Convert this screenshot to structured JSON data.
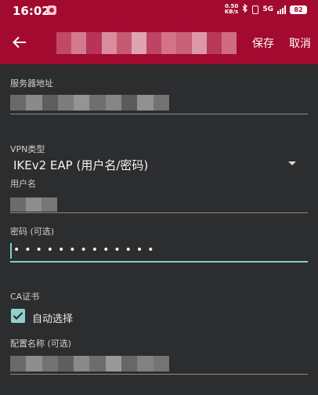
{
  "status_bar": {
    "time": "16:02",
    "net_speed_value": "0.50",
    "net_speed_unit": "KB/s",
    "network": "5G",
    "battery": "82"
  },
  "toolbar": {
    "save_label": "保存",
    "cancel_label": "取消"
  },
  "form": {
    "server_label": "服务器地址",
    "vpn_type_label": "VPN类型",
    "vpn_type_value": "IKEv2 EAP (用户名/密码)",
    "username_label": "用户名",
    "password_label": "密码 (可选)",
    "password_value": "•••••••••••••",
    "ca_label": "CA证书",
    "auto_select_label": "自动选择",
    "profile_name_label": "配置名称 (可选)"
  },
  "colors": {
    "brand": "#a30a30",
    "accent": "#7ccfcb",
    "background": "#2c2d2f"
  }
}
